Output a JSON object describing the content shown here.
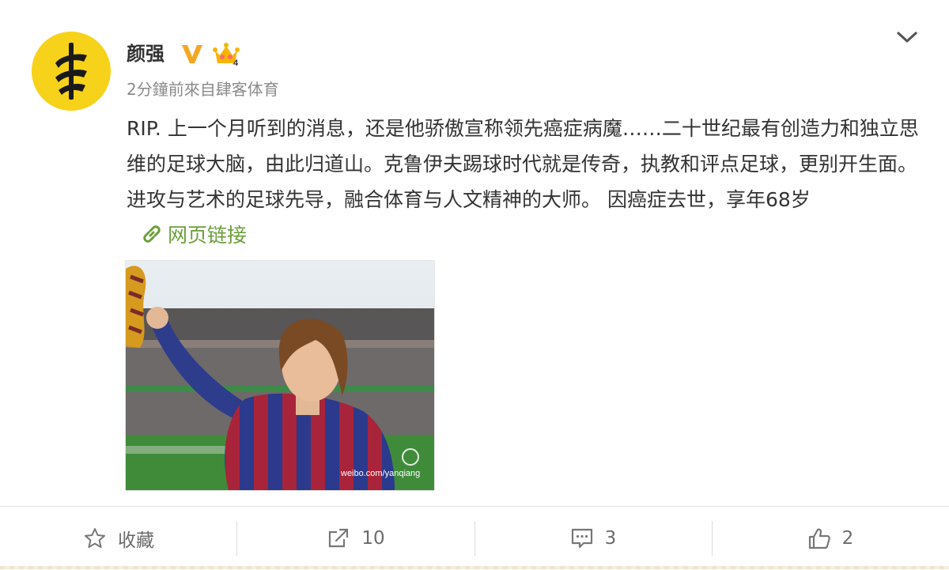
{
  "user": {
    "name": "颜强",
    "meta": "2分鐘前來自肆客体育",
    "crown_level": "4"
  },
  "post": {
    "text": "RIP. 上一个月听到的消息，还是他骄傲宣称领先癌症病魔……二十世纪最有创造力和独立思维的足球大脑，由此归道山。克鲁伊夫踢球时代就是传奇，执教和评点足球，更别开生面。进攻与艺术的足球先导，融合体育与人文精神的大师。  因癌症去世，享年68岁",
    "link_label": "网页链接",
    "image_watermark": "weibo.com/yanqiang"
  },
  "actions": {
    "favorite_label": "收藏",
    "repost_count": "10",
    "comment_count": "3",
    "like_count": "2"
  },
  "colors": {
    "avatar_bg": "#f7d21a",
    "verified": "#f5a623",
    "link": "#6b9e3a",
    "meta": "#8a8a8a"
  }
}
